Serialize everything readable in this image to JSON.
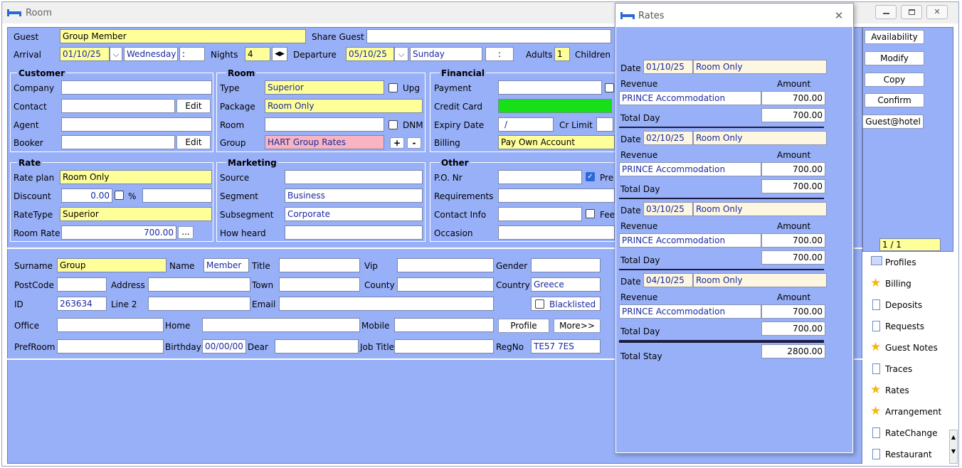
{
  "window": {
    "title": "Room"
  },
  "guest": {
    "label": "Guest",
    "value": "Group Member",
    "share_label": "Share Guest",
    "share_value": ""
  },
  "arrival": {
    "label": "Arrival",
    "date": "01/10/25",
    "day": "Wednesday",
    "time": ":",
    "nights_label": "Nights",
    "nights": "4",
    "departure_label": "Departure",
    "dep_date": "05/10/25",
    "dep_day": "Sunday",
    "dep_time": ":",
    "adults_label": "Adults",
    "adults": "1",
    "children_label": "Children"
  },
  "customer": {
    "title": "Customer",
    "company": "Company",
    "contact": "Contact",
    "agent": "Agent",
    "booker": "Booker",
    "edit": "Edit"
  },
  "room": {
    "title": "Room",
    "type_label": "Type",
    "type": "Superior",
    "upg": "Upg",
    "package_label": "Package",
    "package": "Room Only",
    "room_label": "Room",
    "dnm": "DNM",
    "group_label": "Group",
    "group": "HART Group Rates",
    "plus": "+",
    "minus": "-"
  },
  "financial": {
    "title": "Financial",
    "payment": "Payment",
    "credit_card": "Credit Card",
    "expiry": "Expiry Date",
    "expiry_value": "/",
    "cr_limit": "Cr Limit",
    "billing_label": "Billing",
    "billing": "Pay Own Account"
  },
  "rate": {
    "title": "Rate",
    "plan_label": "Rate plan",
    "plan": "Room Only",
    "discount_label": "Discount",
    "discount": "0.00",
    "percent": "%",
    "ratetype_label": "RateType",
    "ratetype": "Superior",
    "roomrate_label": "Room Rate",
    "roomrate": "700.00",
    "dots": "..."
  },
  "marketing": {
    "title": "Marketing",
    "source": "Source",
    "segment_label": "Segment",
    "segment": "Business",
    "subsegment_label": "Subsegment",
    "subsegment": "Corporate",
    "how_heard": "How heard"
  },
  "other": {
    "title": "Other",
    "po": "P.O. Nr",
    "pre": "Pre",
    "requirements": "Requirements",
    "contact_info": "Contact Info",
    "fee": "Fee",
    "occasion": "Occasion"
  },
  "profile": {
    "surname_label": "Surname",
    "surname": "Group",
    "name_label": "Name",
    "name": "Member",
    "title_label": "Title",
    "vip_label": "Vip",
    "gender_label": "Gender",
    "postcode_label": "PostCode",
    "address_label": "Address",
    "town_label": "Town",
    "county_label": "County",
    "country_label": "Country",
    "country": "Greece",
    "id_label": "ID",
    "id": "263634",
    "line2_label": "Line 2",
    "email_label": "Email",
    "blacklisted": "Blacklisted",
    "office_label": "Office",
    "home_label": "Home",
    "mobile_label": "Mobile",
    "profile_btn": "Profile",
    "more_btn": "More>>",
    "prefroom_label": "PrefRoom",
    "birthday_label": "Birthday",
    "birthday": "00/00/00",
    "dear_label": "Dear",
    "jobtitle_label": "Job Title",
    "regno_label": "RegNo",
    "regno": "TE57 7ES"
  },
  "actions": {
    "availability": "Availability",
    "modify": "Modify",
    "copy": "Copy",
    "confirm": "Confirm",
    "guest_hotel": "Guest@hotel",
    "pager": "1 / 1"
  },
  "side": [
    "Profiles",
    "Billing",
    "Deposits",
    "Requests",
    "Guest Notes",
    "Traces",
    "Rates",
    "Arrangement",
    "RateChange",
    "Restaurant"
  ],
  "rates": {
    "title": "Rates",
    "date_label": "Date",
    "revenue_label": "Revenue",
    "amount_label": "Amount",
    "total_day_label": "Total Day",
    "days": [
      {
        "date": "01/10/25",
        "plan": "Room Only",
        "item": "PRINCE Accommodation",
        "amount": "700.00",
        "total": "700.00"
      },
      {
        "date": "02/10/25",
        "plan": "Room Only",
        "item": "PRINCE Accommodation",
        "amount": "700.00",
        "total": "700.00"
      },
      {
        "date": "03/10/25",
        "plan": "Room Only",
        "item": "PRINCE Accommodation",
        "amount": "700.00",
        "total": "700.00"
      },
      {
        "date": "04/10/25",
        "plan": "Room Only",
        "item": "PRINCE Accommodation",
        "amount": "700.00",
        "total": "700.00"
      }
    ],
    "total_stay_label": "Total Stay",
    "total_stay": "2800.00"
  },
  "colors": {
    "panel": "#98b0f8",
    "field_yellow": "#ffff99",
    "group_pink": "#f8b4c0",
    "card_green": "#18e018",
    "link_blue": "#1a2aa0"
  }
}
